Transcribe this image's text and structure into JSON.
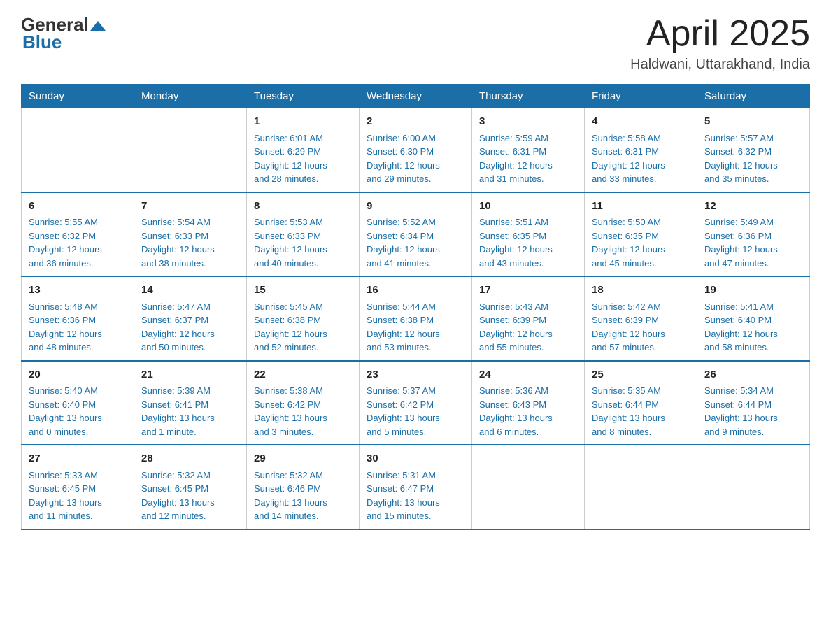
{
  "header": {
    "logo": {
      "general": "General",
      "blue": "Blue"
    },
    "month": "April 2025",
    "location": "Haldwani, Uttarakhand, India"
  },
  "weekdays": [
    "Sunday",
    "Monday",
    "Tuesday",
    "Wednesday",
    "Thursday",
    "Friday",
    "Saturday"
  ],
  "weeks": [
    [
      {
        "day": "",
        "info": ""
      },
      {
        "day": "",
        "info": ""
      },
      {
        "day": "1",
        "info": "Sunrise: 6:01 AM\nSunset: 6:29 PM\nDaylight: 12 hours\nand 28 minutes."
      },
      {
        "day": "2",
        "info": "Sunrise: 6:00 AM\nSunset: 6:30 PM\nDaylight: 12 hours\nand 29 minutes."
      },
      {
        "day": "3",
        "info": "Sunrise: 5:59 AM\nSunset: 6:31 PM\nDaylight: 12 hours\nand 31 minutes."
      },
      {
        "day": "4",
        "info": "Sunrise: 5:58 AM\nSunset: 6:31 PM\nDaylight: 12 hours\nand 33 minutes."
      },
      {
        "day": "5",
        "info": "Sunrise: 5:57 AM\nSunset: 6:32 PM\nDaylight: 12 hours\nand 35 minutes."
      }
    ],
    [
      {
        "day": "6",
        "info": "Sunrise: 5:55 AM\nSunset: 6:32 PM\nDaylight: 12 hours\nand 36 minutes."
      },
      {
        "day": "7",
        "info": "Sunrise: 5:54 AM\nSunset: 6:33 PM\nDaylight: 12 hours\nand 38 minutes."
      },
      {
        "day": "8",
        "info": "Sunrise: 5:53 AM\nSunset: 6:33 PM\nDaylight: 12 hours\nand 40 minutes."
      },
      {
        "day": "9",
        "info": "Sunrise: 5:52 AM\nSunset: 6:34 PM\nDaylight: 12 hours\nand 41 minutes."
      },
      {
        "day": "10",
        "info": "Sunrise: 5:51 AM\nSunset: 6:35 PM\nDaylight: 12 hours\nand 43 minutes."
      },
      {
        "day": "11",
        "info": "Sunrise: 5:50 AM\nSunset: 6:35 PM\nDaylight: 12 hours\nand 45 minutes."
      },
      {
        "day": "12",
        "info": "Sunrise: 5:49 AM\nSunset: 6:36 PM\nDaylight: 12 hours\nand 47 minutes."
      }
    ],
    [
      {
        "day": "13",
        "info": "Sunrise: 5:48 AM\nSunset: 6:36 PM\nDaylight: 12 hours\nand 48 minutes."
      },
      {
        "day": "14",
        "info": "Sunrise: 5:47 AM\nSunset: 6:37 PM\nDaylight: 12 hours\nand 50 minutes."
      },
      {
        "day": "15",
        "info": "Sunrise: 5:45 AM\nSunset: 6:38 PM\nDaylight: 12 hours\nand 52 minutes."
      },
      {
        "day": "16",
        "info": "Sunrise: 5:44 AM\nSunset: 6:38 PM\nDaylight: 12 hours\nand 53 minutes."
      },
      {
        "day": "17",
        "info": "Sunrise: 5:43 AM\nSunset: 6:39 PM\nDaylight: 12 hours\nand 55 minutes."
      },
      {
        "day": "18",
        "info": "Sunrise: 5:42 AM\nSunset: 6:39 PM\nDaylight: 12 hours\nand 57 minutes."
      },
      {
        "day": "19",
        "info": "Sunrise: 5:41 AM\nSunset: 6:40 PM\nDaylight: 12 hours\nand 58 minutes."
      }
    ],
    [
      {
        "day": "20",
        "info": "Sunrise: 5:40 AM\nSunset: 6:40 PM\nDaylight: 13 hours\nand 0 minutes."
      },
      {
        "day": "21",
        "info": "Sunrise: 5:39 AM\nSunset: 6:41 PM\nDaylight: 13 hours\nand 1 minute."
      },
      {
        "day": "22",
        "info": "Sunrise: 5:38 AM\nSunset: 6:42 PM\nDaylight: 13 hours\nand 3 minutes."
      },
      {
        "day": "23",
        "info": "Sunrise: 5:37 AM\nSunset: 6:42 PM\nDaylight: 13 hours\nand 5 minutes."
      },
      {
        "day": "24",
        "info": "Sunrise: 5:36 AM\nSunset: 6:43 PM\nDaylight: 13 hours\nand 6 minutes."
      },
      {
        "day": "25",
        "info": "Sunrise: 5:35 AM\nSunset: 6:44 PM\nDaylight: 13 hours\nand 8 minutes."
      },
      {
        "day": "26",
        "info": "Sunrise: 5:34 AM\nSunset: 6:44 PM\nDaylight: 13 hours\nand 9 minutes."
      }
    ],
    [
      {
        "day": "27",
        "info": "Sunrise: 5:33 AM\nSunset: 6:45 PM\nDaylight: 13 hours\nand 11 minutes."
      },
      {
        "day": "28",
        "info": "Sunrise: 5:32 AM\nSunset: 6:45 PM\nDaylight: 13 hours\nand 12 minutes."
      },
      {
        "day": "29",
        "info": "Sunrise: 5:32 AM\nSunset: 6:46 PM\nDaylight: 13 hours\nand 14 minutes."
      },
      {
        "day": "30",
        "info": "Sunrise: 5:31 AM\nSunset: 6:47 PM\nDaylight: 13 hours\nand 15 minutes."
      },
      {
        "day": "",
        "info": ""
      },
      {
        "day": "",
        "info": ""
      },
      {
        "day": "",
        "info": ""
      }
    ]
  ]
}
